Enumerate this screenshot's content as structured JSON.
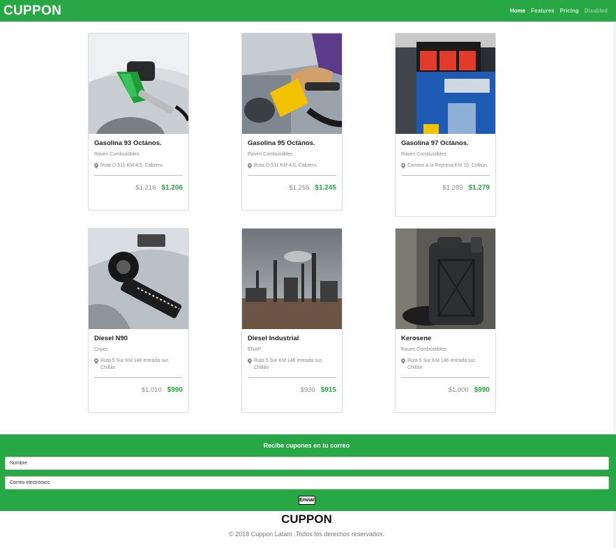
{
  "navbar": {
    "brand": "CUPPON",
    "links": [
      {
        "label": "Home",
        "state": "active"
      },
      {
        "label": "Features",
        "state": "normal"
      },
      {
        "label": "Pricing",
        "state": "normal"
      },
      {
        "label": "Disabled",
        "state": "disabled"
      }
    ]
  },
  "colors": {
    "brand_green": "#28a745",
    "price_new": "#28a745",
    "muted": "#8a8a8a"
  },
  "products": [
    {
      "title": "Gasolina 93 Octános.",
      "vendor": "Raven Combustibles",
      "address": "Ruta O-511 KM 4,5, Cabrero.",
      "old_price": "$1.216",
      "new_price": "$1.206",
      "image": "fuel-nozzle-green-photo"
    },
    {
      "title": "Gasolina 95 Octános.",
      "vendor": "Raven Combustibles",
      "address": "Ruta O-511 KM 4,5, Cabrero.",
      "old_price": "$1.255",
      "new_price": "$1.245",
      "image": "fuel-nozzle-yellow-photo"
    },
    {
      "title": "Gasolina 97 Octános.",
      "vendor": "Raven Combustibles",
      "address": "Camino a la Represa KM 10, Colbún.",
      "old_price": "$1.289",
      "new_price": "$1.279",
      "image": "fuel-pump-display-photo"
    },
    {
      "title": "Diesel N90",
      "vendor": "Copec",
      "address": "Ruta 5 Sur KM 146 entrada sur, Chillán",
      "old_price": "$1.010",
      "new_price": "$990",
      "image": "diesel-nozzle-photo"
    },
    {
      "title": "Diesel Industrial",
      "vendor": "ENAP",
      "address": "Ruta 5 Sur KM 146 entrada sur, Chillán",
      "old_price": "$930",
      "new_price": "$915",
      "image": "refinery-photo"
    },
    {
      "title": "Kerosene",
      "vendor": "Raven Combustibles",
      "address": "Ruta 5 Sur KM 146 entrada sur, Chillán",
      "old_price": "$1.000",
      "new_price": "$990",
      "image": "jerrycan-photo"
    }
  ],
  "subscribe": {
    "title": "Recibe cupones en tu correo",
    "name_placeholder": "Nombre",
    "email_placeholder": "Correo electrónico",
    "submit_label": "Enviar"
  },
  "footer": {
    "brand": "CUPPON",
    "copyright": "© 2018 Cuppon Latam .Todos los derechos reservados."
  }
}
